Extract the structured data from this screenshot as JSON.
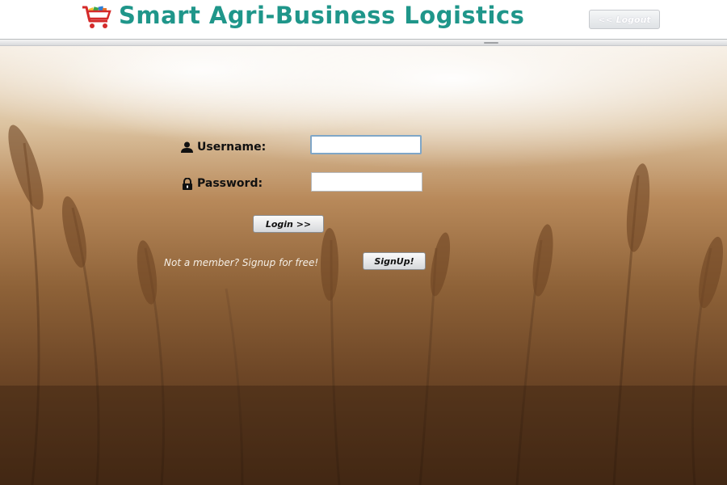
{
  "header": {
    "title": "Smart Agri-Business Logistics",
    "logo_icon": "shopping-cart-icon",
    "logout_label": "<< Logout"
  },
  "login_form": {
    "username_label": "Username:",
    "username_icon": "user-icon",
    "username_value": "",
    "password_label": "Password:",
    "password_icon": "lock-icon",
    "password_value": "",
    "login_button": "Login >>",
    "signup_prompt": "Not a member? Signup for free!",
    "signup_button": "SignUp!"
  },
  "colors": {
    "title": "#1f968a",
    "cart_red": "#d42a2a"
  }
}
